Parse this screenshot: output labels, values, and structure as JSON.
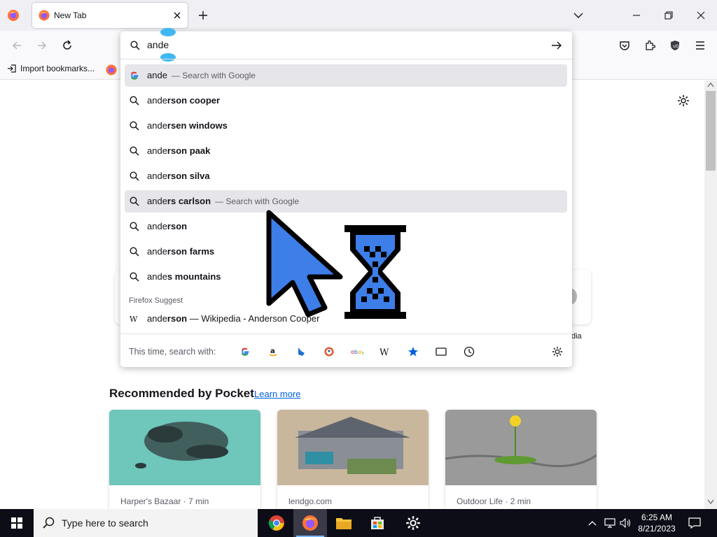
{
  "browser": {
    "tab": {
      "title": "New Tab"
    },
    "bookmarks_bar": {
      "import_label": "Import bookmarks..."
    }
  },
  "urlbar": {
    "input_value": "ande",
    "suggestions": [
      {
        "typed": "ande",
        "completion": "",
        "action": "— Search with Google",
        "icon": "google-g-icon",
        "highlighted": true
      },
      {
        "typed": "ande",
        "completion": "rson cooper",
        "action": "",
        "icon": "search-icon",
        "highlighted": false
      },
      {
        "typed": "ande",
        "completion": "rsen windows",
        "action": "",
        "icon": "search-icon",
        "highlighted": false
      },
      {
        "typed": "ande",
        "completion": "rson paak",
        "action": "",
        "icon": "search-icon",
        "highlighted": false
      },
      {
        "typed": "ande",
        "completion": "rson silva",
        "action": "",
        "icon": "search-icon",
        "highlighted": false
      },
      {
        "typed": "ande",
        "completion": "rs carlson",
        "action": "— Search with Google",
        "icon": "search-icon",
        "highlighted": true
      },
      {
        "typed": "ande",
        "completion": "rson",
        "action": "",
        "icon": "search-icon",
        "highlighted": false
      },
      {
        "typed": "ande",
        "completion": "rson farms",
        "action": "",
        "icon": "search-icon",
        "highlighted": false
      },
      {
        "typed": "ande",
        "completion": "s mountains",
        "action": "",
        "icon": "search-icon",
        "highlighted": false
      }
    ],
    "group_label": "Firefox Suggest",
    "firefox_suggest": {
      "typed": "ande",
      "completion": "rson",
      "rest": " — Wikipedia - Anderson Cooper",
      "icon": "wikipedia-icon"
    },
    "oneoff_label": "This time, search with:",
    "oneoff_engines": [
      "google-icon",
      "amazon-icon",
      "bing-icon",
      "duckduckgo-icon",
      "ebay-icon",
      "wikipedia-icon",
      "bookmarks-star-icon",
      "tabs-icon",
      "history-icon"
    ]
  },
  "newtab": {
    "top_site_partial_label": "dia",
    "pocket": {
      "title": "Recommended by Pocket",
      "learn_more": "Learn more",
      "cards": [
        {
          "source": "Harper's Bazaar · 7 min"
        },
        {
          "source": "lendgo.com"
        },
        {
          "source": "Outdoor Life · 2 min"
        }
      ]
    }
  },
  "taskbar": {
    "search_placeholder": "Type here to search",
    "time": "6:25 AM",
    "date": "8/21/2023"
  },
  "colors": {
    "accent_link": "#0061e0",
    "highlight_row": "#e6e6ea",
    "cursor_blue": "#3d7ee8",
    "taskbar": "#0d0d17"
  }
}
